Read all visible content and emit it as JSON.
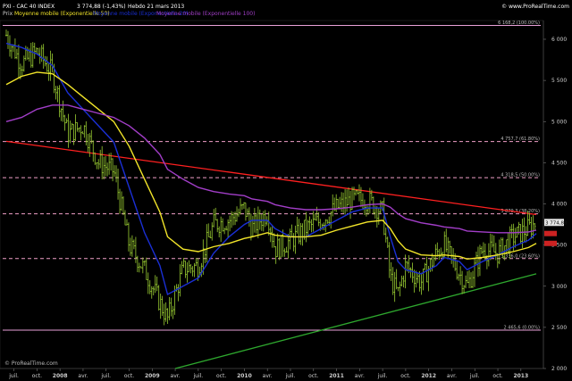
{
  "header": {
    "line1_symbol": "PXI - CAC 40 INDEX",
    "line1_price": "3 774,88 (-1,43%)",
    "line1_period": "Hebdo  21 mars 2013",
    "brand": "© www.ProRealTime.com",
    "line2_prefix": "Prix",
    "legend_ma50": "Moyenne mobile (Exponentielle 50)",
    "legend_ma20": "Moyenne mobile (Exponentielle 20)",
    "legend_ma100": "Moyenne mobile (Exponentielle 100)"
  },
  "footer": {
    "credit": "© ProRealTime.com"
  },
  "colors": {
    "background": "#000000",
    "candle": "#9acd32",
    "ma20": "#1a2fd6",
    "ma50": "#f2e52a",
    "ma100": "#a23ec8",
    "fib_solid": "#e8a0d8",
    "fib_dashed": "#f0a0c8",
    "red_trend": "#ff2020",
    "green_trend": "#2ea82e",
    "price_tag_bg": "#e6e6e6",
    "ma_tag_bg": "#cc2222"
  },
  "chart_data": {
    "type": "candlestick",
    "title": "PXI - CAC 40 INDEX",
    "timeframe": "Hebdo",
    "y_axis": {
      "ticks": [
        2000,
        2500,
        3000,
        3500,
        4000,
        4500,
        5000,
        5500,
        6000
      ],
      "tick_labels": [
        "2 000",
        "2 500",
        "3 000",
        "3 500",
        "4 000",
        "4 500",
        "5 000",
        "5 500",
        "6 000"
      ],
      "ylim": [
        2000,
        6300
      ]
    },
    "x_axis": {
      "tick_labels": [
        "juil.",
        "oct.",
        "2008",
        "avr.",
        "juil.",
        "oct.",
        "2009",
        "avr.",
        "juil.",
        "oct.",
        "2010",
        "avr.",
        "juil.",
        "oct.",
        "2011",
        "avr.",
        "juil.",
        "oct.",
        "2012",
        "avr.",
        "juil.",
        "oct.",
        "2013"
      ],
      "tick_dates": [
        "2007-07",
        "2007-10",
        "2008-01",
        "2008-04",
        "2008-07",
        "2008-10",
        "2009-01",
        "2009-04",
        "2009-07",
        "2009-10",
        "2010-01",
        "2010-04",
        "2010-07",
        "2010-10",
        "2011-01",
        "2011-04",
        "2011-07",
        "2011-10",
        "2012-01",
        "2012-04",
        "2012-07",
        "2012-10",
        "2013-01"
      ],
      "bold_labels": [
        "2008",
        "2009",
        "2010",
        "2011",
        "2012",
        "2013"
      ]
    },
    "last_price": 3774.88,
    "last_price_label": "3 774,88",
    "change_label": "(-1,43%)",
    "fibonacci_levels": [
      {
        "label": "6 168,2 (100.00%)",
        "value": 6168.2,
        "style": "solid"
      },
      {
        "label": "4 757,7 (61.80%)",
        "value": 4757.7,
        "style": "dashed"
      },
      {
        "label": "4 318,5 (50.00%)",
        "value": 4318.5,
        "style": "dashed"
      },
      {
        "label": "3 879,3 (38.20%)",
        "value": 3879.3,
        "style": "dashed"
      },
      {
        "label": "3 336,0 (23.60%)",
        "value": 3336.0,
        "style": "dashed"
      },
      {
        "label": "2 465,6 (0.00%)",
        "value": 2465.6,
        "style": "solid"
      }
    ],
    "trendlines": [
      {
        "name": "resistance",
        "color": "red",
        "points": [
          [
            "2007-06",
            4760
          ],
          [
            "2013-03",
            3870
          ]
        ]
      },
      {
        "name": "support",
        "color": "green",
        "points": [
          [
            "2009-04",
            2000
          ],
          [
            "2013-03",
            3150
          ]
        ]
      }
    ],
    "price_series": {
      "dates": [
        "2007-06",
        "2007-08",
        "2007-10",
        "2007-12",
        "2008-02",
        "2008-04",
        "2008-06",
        "2008-08",
        "2008-10",
        "2008-12",
        "2009-02",
        "2009-03",
        "2009-05",
        "2009-07",
        "2009-09",
        "2009-11",
        "2010-01",
        "2010-02",
        "2010-04",
        "2010-05",
        "2010-07",
        "2010-09",
        "2010-11",
        "2011-01",
        "2011-03",
        "2011-05",
        "2011-07",
        "2011-08",
        "2011-09",
        "2011-10",
        "2011-12",
        "2012-02",
        "2012-03",
        "2012-05",
        "2012-06",
        "2012-08",
        "2012-10",
        "2012-12",
        "2013-02",
        "2013-03"
      ],
      "close": [
        6050,
        5700,
        5850,
        5600,
        4850,
        4950,
        4500,
        4400,
        3500,
        3200,
        2800,
        2600,
        3200,
        3250,
        3750,
        3800,
        3950,
        3700,
        3900,
        3450,
        3550,
        3700,
        3800,
        3950,
        4050,
        4050,
        3900,
        3100,
        2900,
        3250,
        3050,
        3400,
        3500,
        3150,
        3000,
        3450,
        3400,
        3600,
        3700,
        3775
      ]
    },
    "moving_averages": [
      {
        "name": "Moyenne mobile (Exponentielle 20)",
        "color": "blue",
        "values": [
          5950,
          5900,
          5820,
          5680,
          5350,
          5150,
          4950,
          4750,
          4200,
          3650,
          3250,
          2900,
          3000,
          3100,
          3400,
          3600,
          3750,
          3800,
          3800,
          3700,
          3600,
          3600,
          3700,
          3800,
          3900,
          3950,
          3950,
          3600,
          3300,
          3200,
          3150,
          3250,
          3350,
          3300,
          3200,
          3300,
          3380,
          3480,
          3560,
          3640
        ]
      },
      {
        "name": "Moyenne mobile (Exponentielle 50)",
        "color": "yellow",
        "values": [
          5450,
          5550,
          5600,
          5580,
          5450,
          5300,
          5150,
          5000,
          4700,
          4300,
          3900,
          3600,
          3450,
          3420,
          3480,
          3520,
          3580,
          3600,
          3650,
          3620,
          3600,
          3600,
          3620,
          3680,
          3730,
          3780,
          3800,
          3700,
          3550,
          3450,
          3380,
          3370,
          3380,
          3360,
          3330,
          3350,
          3380,
          3420,
          3470,
          3520
        ]
      },
      {
        "name": "Moyenne mobile (Exponentielle 100)",
        "color": "purple",
        "values": [
          5000,
          5050,
          5150,
          5200,
          5200,
          5150,
          5100,
          5050,
          4950,
          4800,
          4600,
          4420,
          4300,
          4200,
          4150,
          4120,
          4100,
          4060,
          4030,
          3990,
          3950,
          3930,
          3930,
          3940,
          3960,
          3990,
          4000,
          3960,
          3880,
          3820,
          3770,
          3740,
          3720,
          3700,
          3670,
          3660,
          3650,
          3650,
          3660,
          3680
        ]
      }
    ]
  }
}
